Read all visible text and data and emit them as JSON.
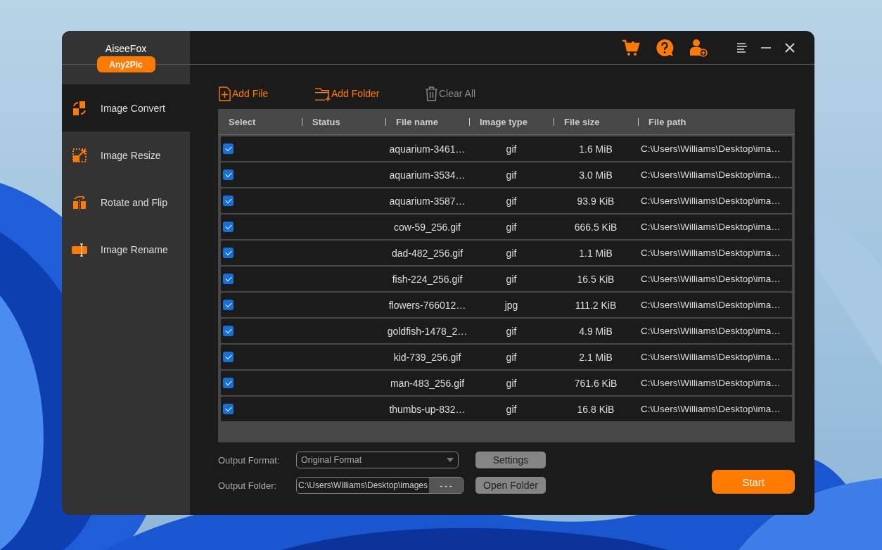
{
  "app": {
    "brand": "AiseeFox",
    "product": "Any2Pic"
  },
  "sidebar": {
    "items": [
      {
        "label": "Image Convert",
        "kind": "convert",
        "selected": true
      },
      {
        "label": "Image Resize",
        "kind": "resize",
        "selected": false
      },
      {
        "label": "Rotate and Flip",
        "kind": "rotate",
        "selected": false
      },
      {
        "label": "Image Rename",
        "kind": "rename",
        "selected": false
      }
    ]
  },
  "toolbar": [
    {
      "label": "Add File",
      "kind": "add-file"
    },
    {
      "label": "Add Folder",
      "kind": "add-folder"
    },
    {
      "label": "Clear All",
      "kind": "clear"
    }
  ],
  "table": {
    "columns": [
      "Select",
      "Status",
      "File name",
      "Image type",
      "File size",
      "File path"
    ],
    "rows": [
      {
        "checked": true,
        "file_name": "aquarium-3461…",
        "image_type": "gif",
        "file_size": "1.6 MiB",
        "file_path": "C:\\Users\\Williams\\Desktop\\ima…"
      },
      {
        "checked": true,
        "file_name": "aquarium-3534…",
        "image_type": "gif",
        "file_size": "3.0 MiB",
        "file_path": "C:\\Users\\Williams\\Desktop\\ima…"
      },
      {
        "checked": true,
        "file_name": "aquarium-3587…",
        "image_type": "gif",
        "file_size": "93.9 KiB",
        "file_path": "C:\\Users\\Williams\\Desktop\\ima…"
      },
      {
        "checked": true,
        "file_name": "cow-59_256.gif",
        "image_type": "gif",
        "file_size": "666.5 KiB",
        "file_path": "C:\\Users\\Williams\\Desktop\\ima…"
      },
      {
        "checked": true,
        "file_name": "dad-482_256.gif",
        "image_type": "gif",
        "file_size": "1.1 MiB",
        "file_path": "C:\\Users\\Williams\\Desktop\\ima…"
      },
      {
        "checked": true,
        "file_name": "fish-224_256.gif",
        "image_type": "gif",
        "file_size": "16.5 KiB",
        "file_path": "C:\\Users\\Williams\\Desktop\\ima…"
      },
      {
        "checked": true,
        "file_name": "flowers-766012…",
        "image_type": "jpg",
        "file_size": "111.2 KiB",
        "file_path": "C:\\Users\\Williams\\Desktop\\ima…"
      },
      {
        "checked": true,
        "file_name": "goldfish-1478_2…",
        "image_type": "gif",
        "file_size": "4.9 MiB",
        "file_path": "C:\\Users\\Williams\\Desktop\\ima…"
      },
      {
        "checked": true,
        "file_name": "kid-739_256.gif",
        "image_type": "gif",
        "file_size": "2.1 MiB",
        "file_path": "C:\\Users\\Williams\\Desktop\\ima…"
      },
      {
        "checked": true,
        "file_name": "man-483_256.gif",
        "image_type": "gif",
        "file_size": "761.6 KiB",
        "file_path": "C:\\Users\\Williams\\Desktop\\ima…"
      },
      {
        "checked": true,
        "file_name": "thumbs-up-832…",
        "image_type": "gif",
        "file_size": "16.8 KiB",
        "file_path": "C:\\Users\\Williams\\Desktop\\ima…"
      }
    ]
  },
  "output": {
    "format_label": "Output Format:",
    "format_value": "Original Format",
    "settings_button": "Settings",
    "folder_label": "Output Folder:",
    "folder_value": "C:\\Users\\Williams\\Desktop\\images",
    "browse_button": "- - -",
    "open_folder_button": "Open Folder"
  },
  "start_button": "Start"
}
